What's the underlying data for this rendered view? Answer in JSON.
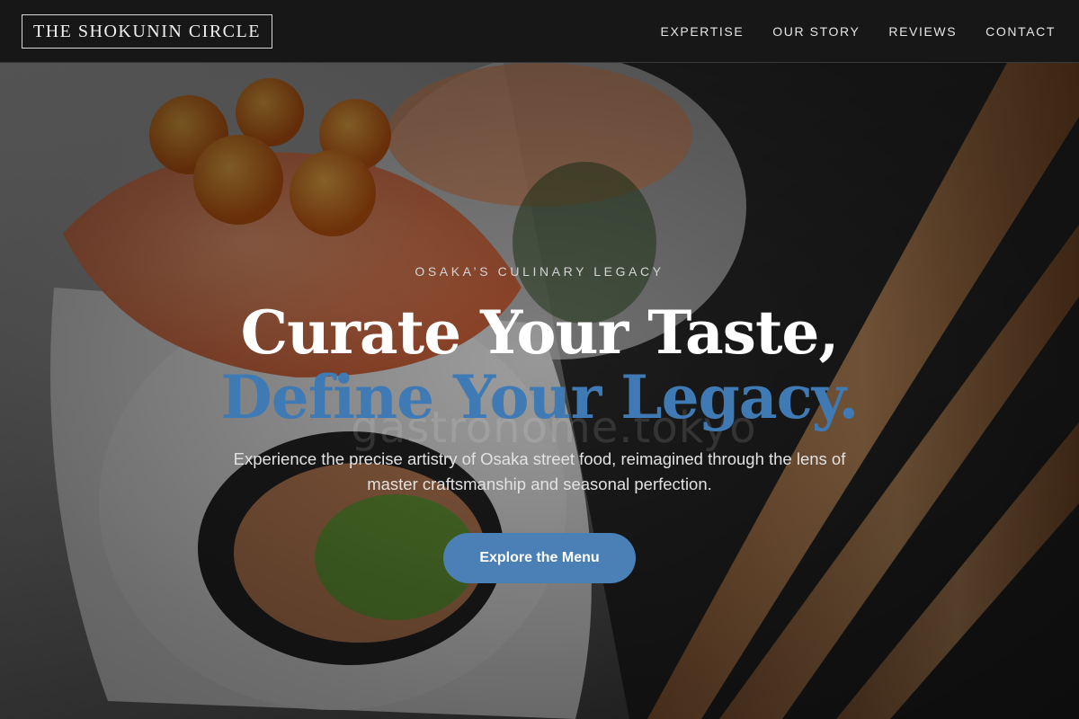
{
  "nav": {
    "brand": "THE SHOKUNIN CIRCLE",
    "links": [
      "EXPERTISE",
      "OUR STORY",
      "REVIEWS",
      "CONTACT"
    ]
  },
  "hero": {
    "eyebrow": "OSAKA’S CULINARY LEGACY",
    "headline_line1": "Curate Your Taste,",
    "headline_line2": "Define Your Legacy.",
    "watermark": "gastronome.tokyo",
    "subtext": "Experience the precise artistry of Osaka street food, reimagined through the lens of master craftsmanship and seasonal perfection.",
    "cta_label": "Explore the Menu"
  },
  "colors": {
    "navbar_bg": "#171717",
    "accent_blue": "#3f7ab5",
    "cta_bg": "#4a80b6",
    "text_white": "#ffffff"
  }
}
